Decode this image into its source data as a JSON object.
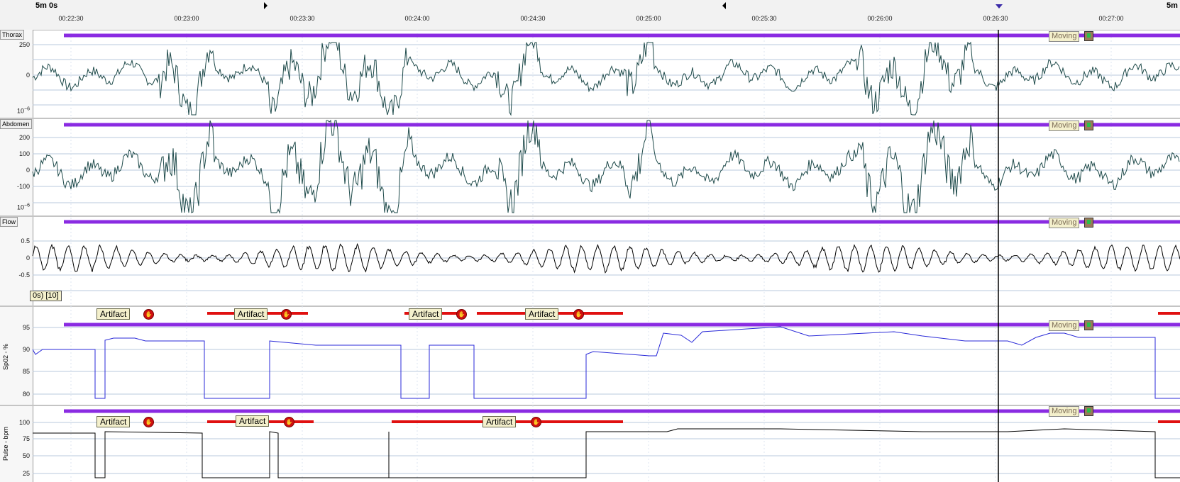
{
  "timeline": {
    "left_span": "5m 0s",
    "right_span": "5m",
    "ticks": [
      "00:22:30",
      "00:23:00",
      "00:23:30",
      "00:24:00",
      "00:24:30",
      "00:25:00",
      "00:25:30",
      "00:26:00",
      "00:26:30",
      "00:27:00"
    ]
  },
  "channels": {
    "thorax": {
      "label": "Thorax",
      "y_labels": [
        "250",
        "0"
      ],
      "scale": "10",
      "scale_exp": "−6"
    },
    "abdomen": {
      "label": "Abdomen",
      "y_labels": [
        "200",
        "100",
        "0",
        "-100"
      ],
      "scale": "10",
      "scale_exp": "−6"
    },
    "flow": {
      "label": "Flow",
      "y_labels": [
        "0.5",
        "0",
        "-0.5"
      ]
    },
    "spo2": {
      "label": "Sp02 - %",
      "y_labels": [
        "95",
        "90",
        "85",
        "80"
      ],
      "counter": "0s) [10]"
    },
    "pulse": {
      "label": "Pulse - bpm",
      "y_labels": [
        "100",
        "75",
        "50",
        "25"
      ]
    }
  },
  "events": {
    "moving_label": "Moving",
    "artifact_label": "Artifact"
  },
  "colors": {
    "event_bar": "#8a2be2",
    "artifact_bar": "#e01010",
    "thorax_trace": "#1e4a4a",
    "spo2_trace": "#2a2ad8",
    "pulse_trace": "#000000",
    "cursor": "#000000"
  }
}
